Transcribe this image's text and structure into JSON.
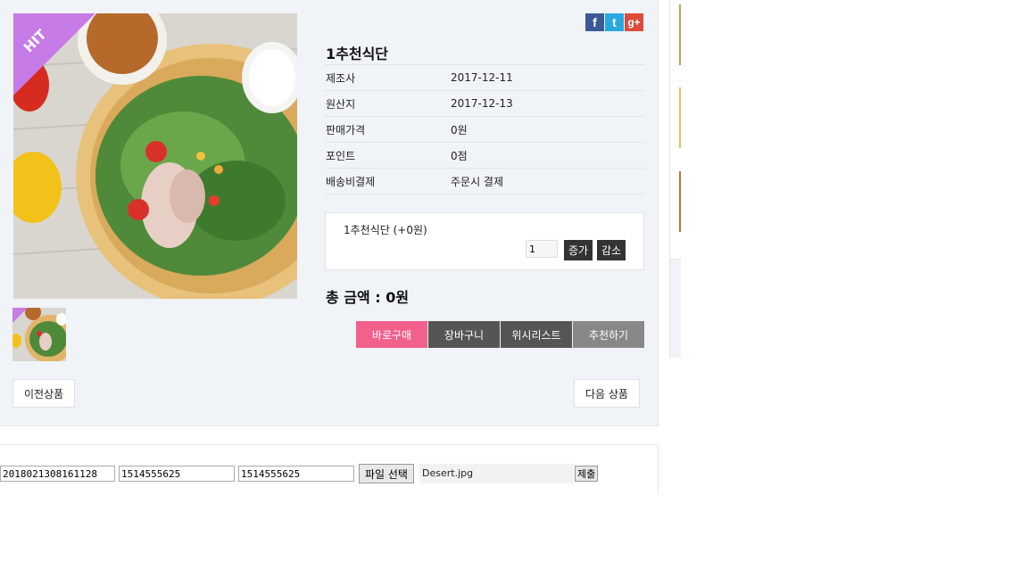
{
  "product": {
    "title": "1추천식단",
    "badge": "HIT",
    "info": [
      {
        "label": "제조사",
        "value": "2017-12-11"
      },
      {
        "label": "원산지",
        "value": "2017-12-13"
      },
      {
        "label": "판매가격",
        "value": "0원"
      },
      {
        "label": "포인트",
        "value": "0점"
      },
      {
        "label": "배송비결제",
        "value": "주문시 결제"
      }
    ],
    "option": {
      "name": "1추천식단 (+0원)",
      "qty": "1",
      "increase_label": "증가",
      "decrease_label": "감소"
    },
    "total": "총 금액 : 0원",
    "actions": {
      "buy_now": "바로구매",
      "cart": "장바구니",
      "wishlist": "위시리스트",
      "recommend": "추천하기"
    },
    "nav": {
      "prev": "이전상품",
      "next": "다음 상품"
    }
  },
  "social": {
    "facebook": "f",
    "twitter": "t",
    "googleplus": "g+"
  },
  "form": {
    "field1": "2018021308161128",
    "field2": "1514555625",
    "field3": "1514555625",
    "file_button": "파일 선택",
    "file_name": "Desert.jpg",
    "submit": "제출"
  },
  "colors": {
    "buy_now": "#f2608c",
    "cart": "#555555",
    "wishlist": "#555555",
    "recommend": "#888888",
    "badge": "#c77be6"
  }
}
